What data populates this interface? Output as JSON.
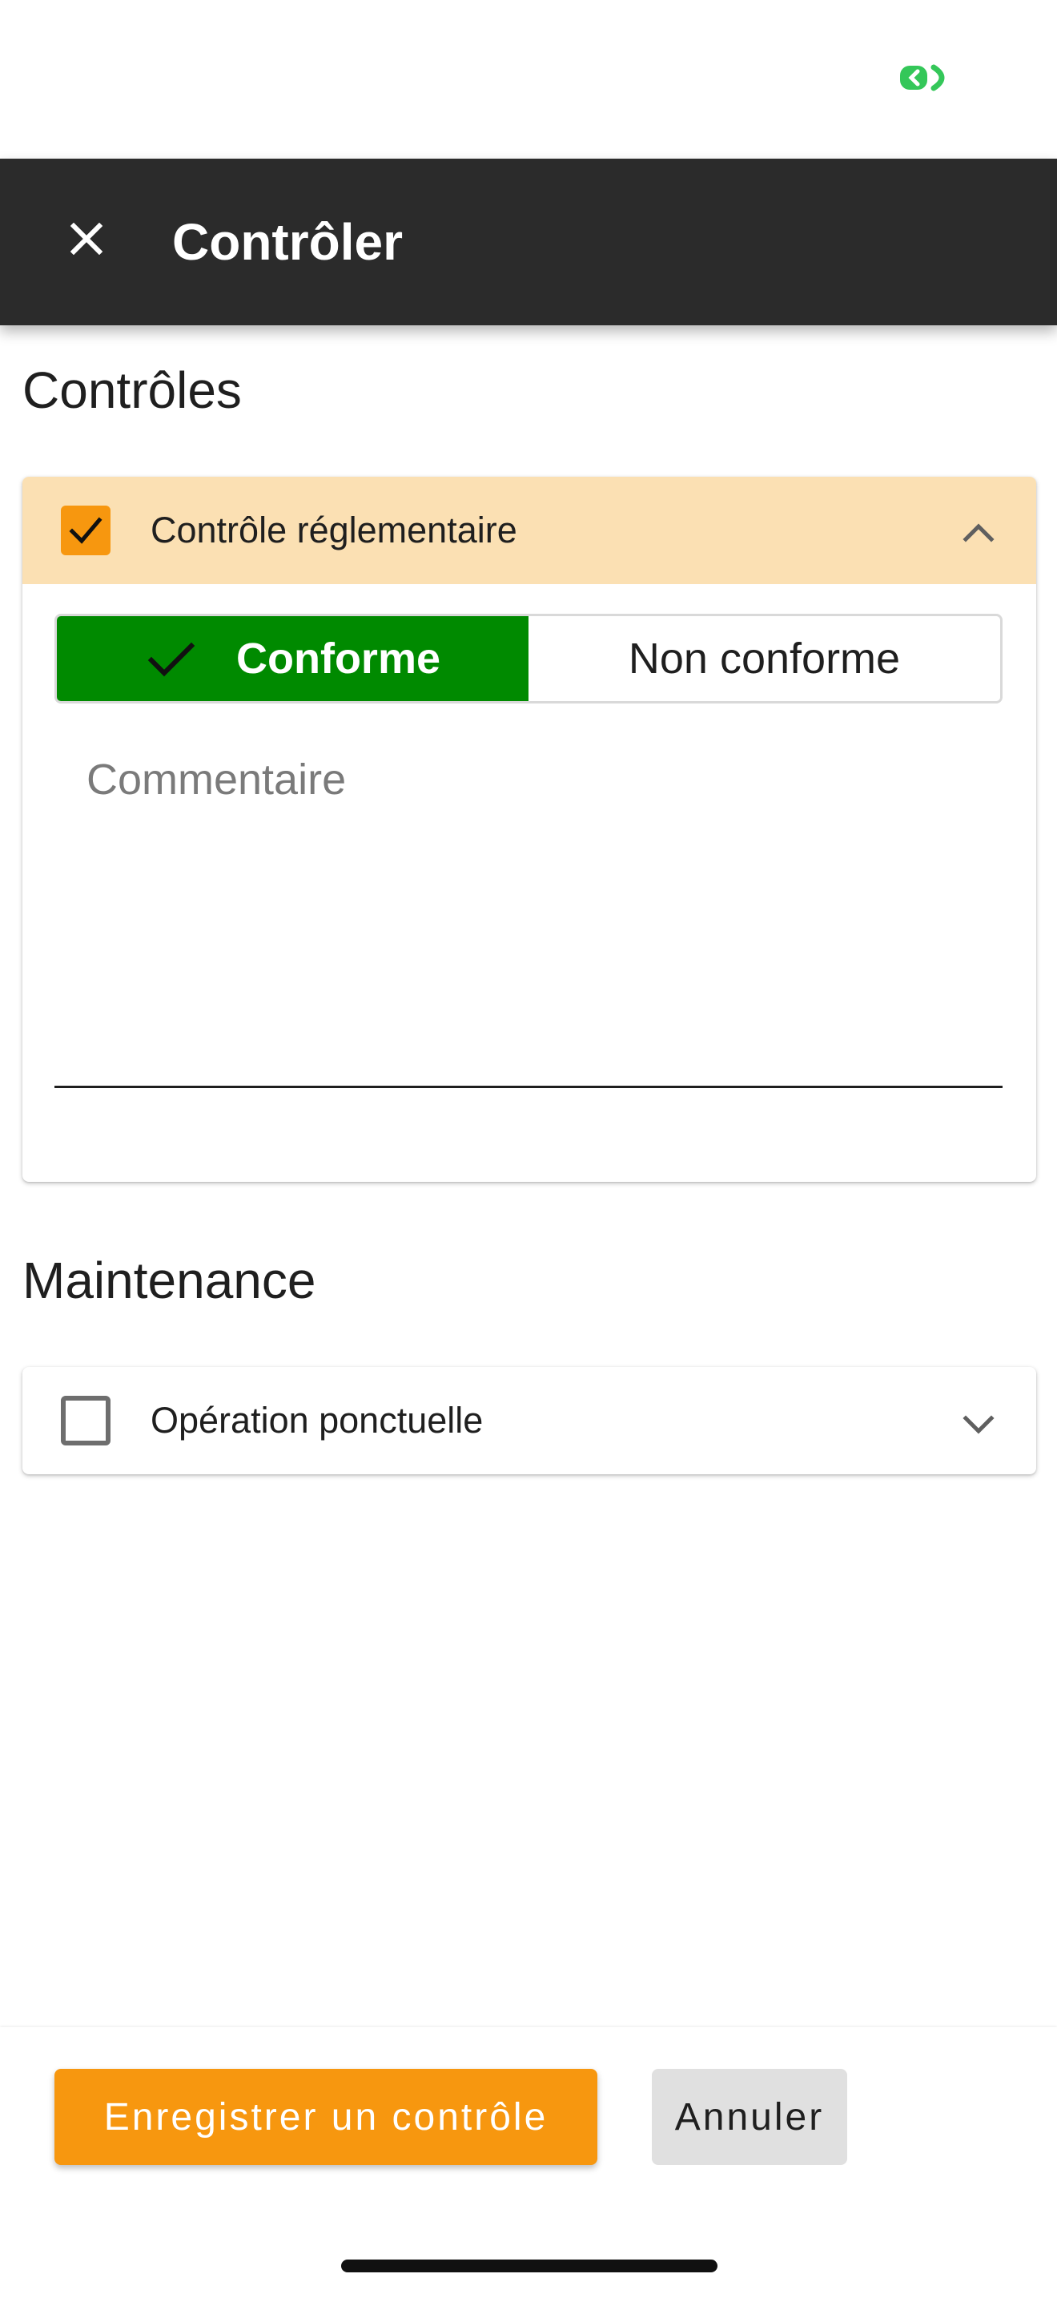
{
  "app_bar": {
    "title": "Contrôler",
    "close_icon": "close-icon",
    "background": "#2b2b2b"
  },
  "sections": {
    "controls": {
      "title": "Contrôles",
      "card": {
        "label": "Contrôle réglementaire",
        "checked": true,
        "expanded": true,
        "chevron_icon": "chevron-up-icon",
        "toggle": {
          "options": [
            "Conforme",
            "Non conforme"
          ],
          "selected": "Conforme",
          "selected_icon": "check-icon"
        },
        "comment": {
          "placeholder": "Commentaire",
          "value": ""
        }
      }
    },
    "maintenance": {
      "title": "Maintenance",
      "card": {
        "label": "Opération ponctuelle",
        "checked": false,
        "expanded": false,
        "chevron_icon": "chevron-down-icon"
      }
    }
  },
  "footer": {
    "save_label": "Enregistrer un contrôle",
    "cancel_label": "Annuler"
  },
  "colors": {
    "accent": "#f7970f",
    "accent_light": "#fbe0b3",
    "success": "#008a00",
    "status_indicator": "#34c759"
  }
}
